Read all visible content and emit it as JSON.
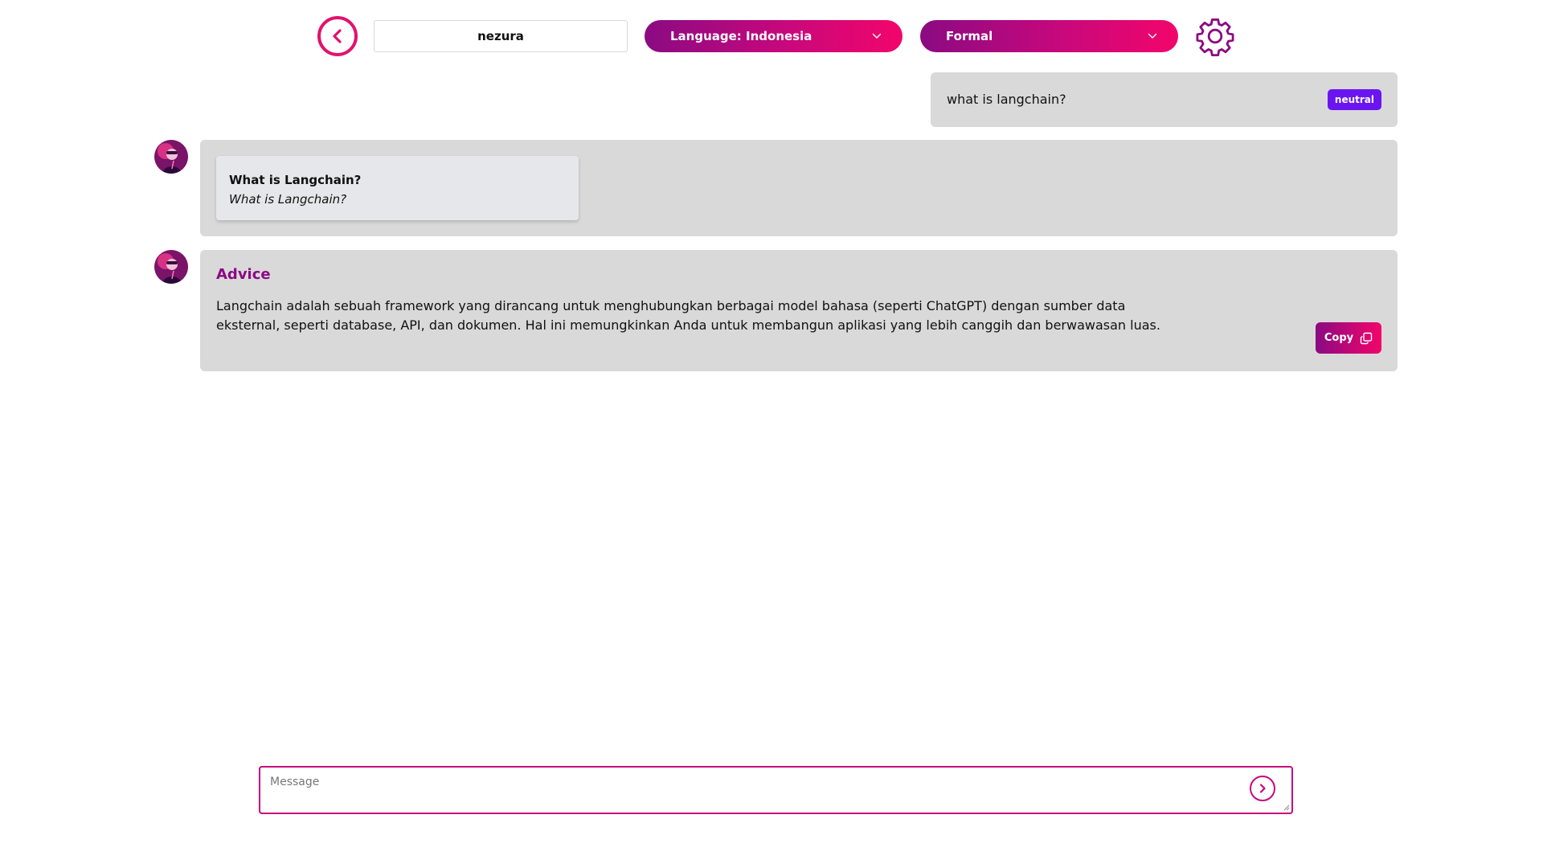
{
  "header": {
    "back_icon": "chevron-left-circle-icon",
    "name": "nezura",
    "language_select": "Language: Indonesia",
    "tone_select": "Formal",
    "settings_icon": "gear-icon"
  },
  "conversation": {
    "user_message": {
      "text": "what is langchain?",
      "badge": "neutral"
    },
    "bot_message_1": {
      "title": "What is Langchain?",
      "subtitle": "What is Langchain?"
    },
    "bot_message_2": {
      "heading": "Advice",
      "body": "Langchain adalah sebuah framework yang dirancang untuk menghubungkan berbagai model bahasa (seperti ChatGPT) dengan sumber data eksternal, seperti database, API, dan dokumen. Hal ini memungkinkan Anda untuk membangun aplikasi yang lebih canggih dan berwawasan luas.",
      "copy_label": "Copy"
    }
  },
  "composer": {
    "placeholder": "Message",
    "value": ""
  },
  "colors": {
    "accent": "#c8087c",
    "accent_dark": "#8b0a82",
    "badge": "#6a15f0",
    "bubble": "#d9d9d9"
  }
}
